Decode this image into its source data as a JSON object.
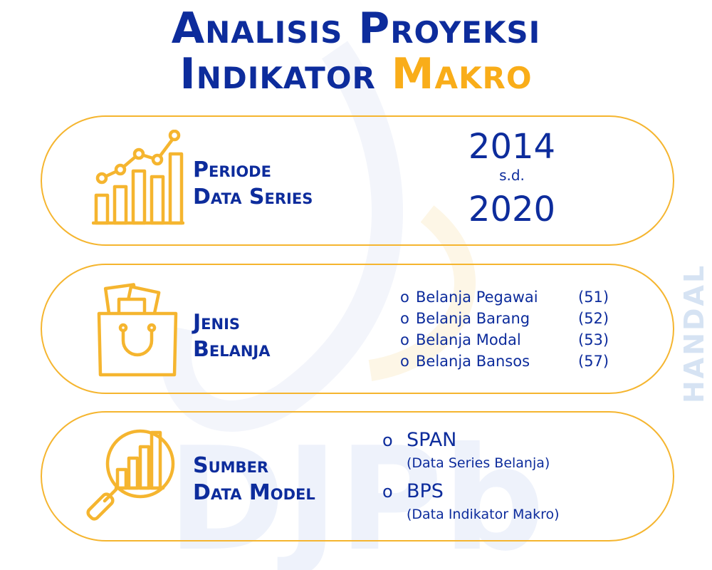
{
  "title": {
    "line1": "Analisis Proyeksi",
    "line2_main": "Indikator ",
    "line2_accent": "Makro"
  },
  "periode": {
    "label_line1": "Periode",
    "label_line2": "Data Series",
    "start_year": "2014",
    "separator": "s.d.",
    "end_year": "2020",
    "icon": "growth-bar-chart-icon"
  },
  "jenis_belanja": {
    "label_line1": "Jenis",
    "label_line2": "Belanja",
    "icon": "shopping-bag-icon",
    "items": [
      {
        "bullet": "o",
        "name": "Belanja Pegawai",
        "code": "(51)"
      },
      {
        "bullet": "o",
        "name": "Belanja Barang",
        "code": "(52)"
      },
      {
        "bullet": "o",
        "name": "Belanja Modal",
        "code": "(53)"
      },
      {
        "bullet": "o",
        "name": "Belanja Bansos",
        "code": "(57)"
      }
    ]
  },
  "sumber": {
    "label_line1": "Sumber",
    "label_line2": "Data Model",
    "icon": "magnifier-chart-icon",
    "sources": [
      {
        "bullet": "o",
        "name": "SPAN",
        "desc": "(Data Series Belanja)"
      },
      {
        "bullet": "o",
        "name": "BPS",
        "desc": "(Data Indikator Makro)"
      }
    ]
  },
  "watermark": {
    "main_text": "DJPb",
    "side_text": "HANDAL"
  },
  "colors": {
    "navy": "#0d2c9c",
    "accent": "#f9ad19",
    "border": "#f5b52f"
  }
}
